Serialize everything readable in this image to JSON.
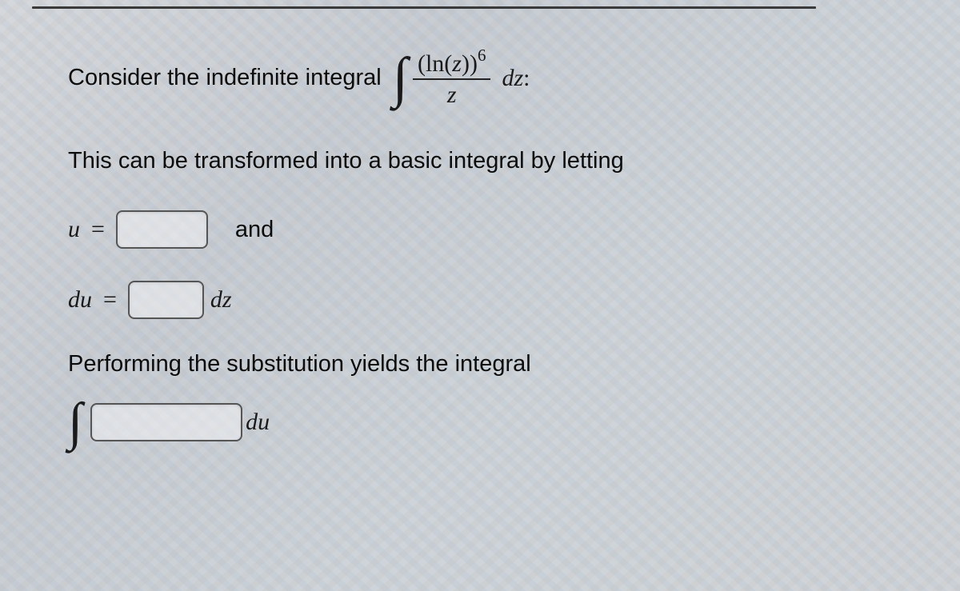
{
  "problem": {
    "intro_text": "Consider the indefinite integral",
    "integral": {
      "numerator_base": "(ln(z))",
      "numerator_exp": "6",
      "denominator": "z",
      "differential_var": "z",
      "trailing_text": "dz:"
    },
    "transform_text": "This can be transformed into a basic integral by letting",
    "u_label": "u",
    "equals": "=",
    "and_text": "and",
    "du_label": "du",
    "dz_label": "dz",
    "substitution_text": "Performing the substitution yields the integral",
    "final_du": "du"
  }
}
